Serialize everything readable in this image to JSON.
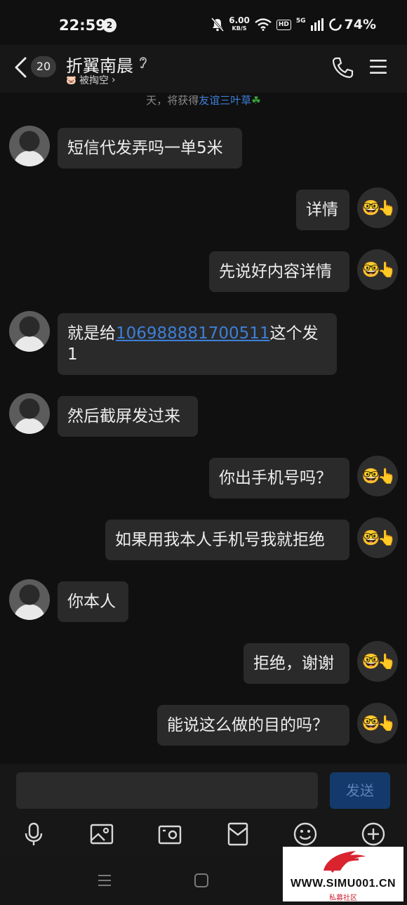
{
  "status_bar": {
    "time": "22:59",
    "notification_count": "2",
    "net_speed_value": "6.00",
    "net_speed_unit": "KB/S",
    "hd_label": "HD",
    "signal_label": "5G",
    "battery": "74%"
  },
  "header": {
    "unread_count": "20",
    "contact_name": "折翼南晨",
    "subtitle_emoji": "🐷",
    "subtitle": "被掏空",
    "subtitle_chevron": "›"
  },
  "friendship": {
    "prefix": "天，将获得",
    "highlight": "友谊三叶草",
    "emoji": "☘"
  },
  "messages": [
    {
      "side": "them",
      "text": "短信代发弄吗一单5米"
    },
    {
      "side": "me",
      "text": "详情"
    },
    {
      "side": "me",
      "text": "先说好内容详情"
    },
    {
      "side": "them",
      "text_prefix": "就是给",
      "link": "106988881700511",
      "text_suffix": "这个发",
      "line2": "1"
    },
    {
      "side": "them",
      "text": "然后截屏发过来"
    },
    {
      "side": "me",
      "text": "你出手机号吗？"
    },
    {
      "side": "me",
      "text": "如果用我本人手机号我就拒绝"
    },
    {
      "side": "them",
      "text": "你本人"
    },
    {
      "side": "me",
      "text": "拒绝，谢谢"
    },
    {
      "side": "me",
      "text": "能说这么做的目的吗？"
    }
  ],
  "my_avatar_emoji": "🤓👆",
  "input": {
    "value": "",
    "send_label": "发送"
  },
  "watermark": {
    "url": "WWW.SIMU001.CN",
    "subtitle": "私募社区"
  },
  "colors": {
    "background": "#101010",
    "bubble": "#2a2a2a",
    "link": "#3d7fd9",
    "send_button": "#143a6c"
  }
}
